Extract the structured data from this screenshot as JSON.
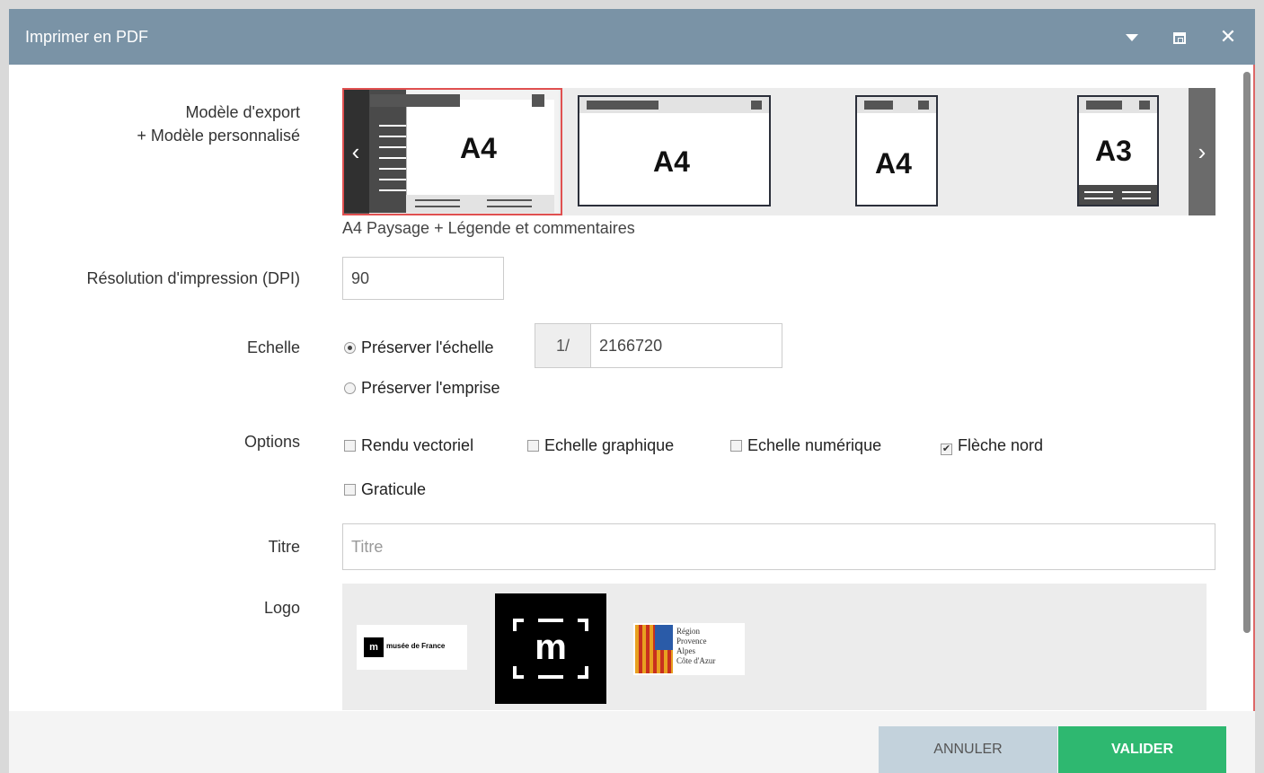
{
  "window": {
    "title": "Imprimer en PDF",
    "dropdown_icon": "caret-down-icon",
    "restore_icon": "restore-icon",
    "close_icon": "close-icon",
    "close_glyph": "✕"
  },
  "form": {
    "model_label_line1": "Modèle d'export",
    "model_label_line2": "+ Modèle personnalisé",
    "templates": [
      {
        "label": "A4",
        "selected": true
      },
      {
        "label": "A4",
        "selected": false
      },
      {
        "label": "A4",
        "selected": false
      },
      {
        "label": "A3",
        "selected": false
      }
    ],
    "prev_glyph": "‹",
    "next_glyph": "›",
    "template_description": "A4 Paysage + Légende et commentaires",
    "dpi_label": "Résolution d'impression (DPI)",
    "dpi_value": "90",
    "scale_label": "Echelle",
    "scale_options": [
      {
        "label": "Préserver l'échelle",
        "checked": true
      },
      {
        "label": "Préserver l'emprise",
        "checked": false
      }
    ],
    "scale_prefix": "1/",
    "scale_value": "2166720",
    "options_label": "Options",
    "options": [
      {
        "label": "Rendu vectoriel",
        "checked": false
      },
      {
        "label": "Echelle graphique",
        "checked": false
      },
      {
        "label": "Echelle numérique",
        "checked": false
      },
      {
        "label": "Flèche nord",
        "checked": true
      },
      {
        "label": "Graticule",
        "checked": false
      }
    ],
    "title_label": "Titre",
    "title_placeholder": "Titre",
    "logo_label": "Logo",
    "logos": [
      {
        "icon": "musee-de-france-logo",
        "text": "musée de France",
        "mark": "m"
      },
      {
        "icon": "m-bracket-logo",
        "mark": "m"
      },
      {
        "icon": "region-paca-logo",
        "lines": [
          "Région",
          "Provence",
          "Alpes",
          "Côte d'Azur"
        ]
      }
    ]
  },
  "footer": {
    "cancel_label": "ANNULER",
    "ok_label": "VALIDER"
  },
  "colors": {
    "titlebar": "#7a93a6",
    "ok_button": "#2eb870",
    "cancel_button": "#c3d2dc",
    "selection_border": "#e05050"
  }
}
